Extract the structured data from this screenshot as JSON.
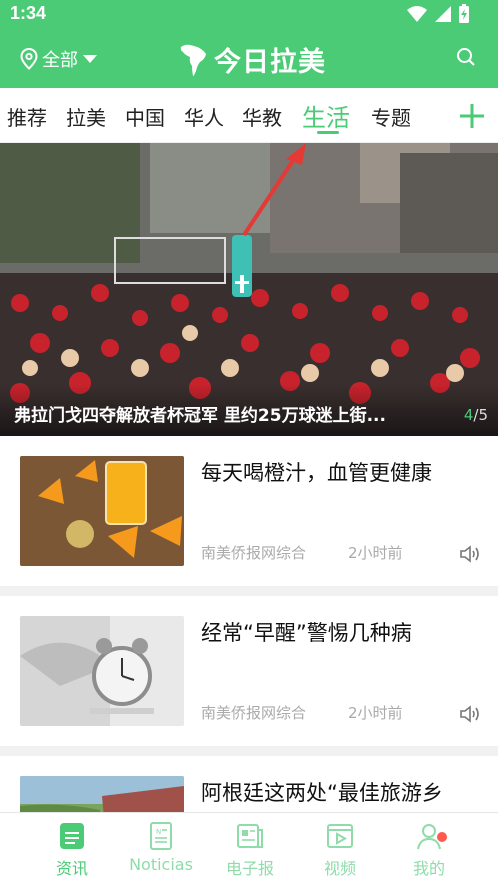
{
  "status_bar": {
    "time": "1:34"
  },
  "header": {
    "location_label": "全部",
    "brand_title": "今日拉美"
  },
  "tabs": [
    {
      "label": "推荐",
      "active": false
    },
    {
      "label": "拉美",
      "active": false
    },
    {
      "label": "中国",
      "active": false
    },
    {
      "label": "华人",
      "active": false
    },
    {
      "label": "华教",
      "active": false
    },
    {
      "label": "生活",
      "active": true
    },
    {
      "label": "专题",
      "active": false
    }
  ],
  "banner": {
    "title": "弗拉门戈四夺解放者杯冠军 里约25万球迷上街...",
    "pager_current": "4",
    "pager_total": "/5"
  },
  "news": [
    {
      "title": "每天喝橙汁，血管更健康",
      "source": "南美侨报网综合",
      "time": "2小时前"
    },
    {
      "title": "经常“早醒”警惕几种病",
      "source": "南美侨报网综合",
      "time": "2小时前"
    },
    {
      "title": "阿根廷这两处“最佳旅游乡村”被点名 你去?",
      "source": "",
      "time": ""
    }
  ],
  "bottom_nav": [
    {
      "label": "资讯",
      "active": true
    },
    {
      "label": "Noticias",
      "active": false
    },
    {
      "label": "电子报",
      "active": false
    },
    {
      "label": "视频",
      "active": false
    },
    {
      "label": "我的",
      "active": false
    }
  ],
  "colors": {
    "brand_green": "#4ccb77",
    "light_green": "#8fdcaa",
    "notification_red": "#ff5b4d"
  }
}
